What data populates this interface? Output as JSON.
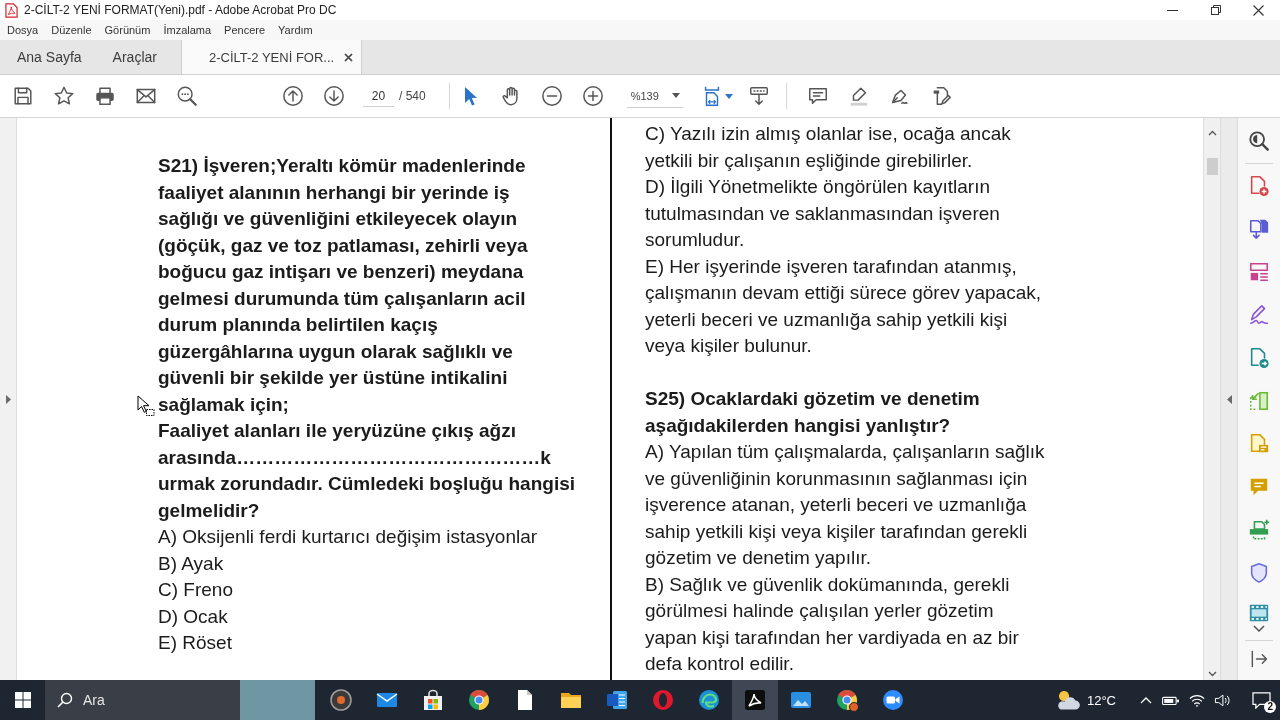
{
  "window": {
    "title": "2-CİLT-2 YENİ FORMAT(Yeni).pdf - Adobe Acrobat Pro DC"
  },
  "menu_bar": {
    "items": [
      "Dosya",
      "Düzenle",
      "Görünüm",
      "İmzalama",
      "Pencere",
      "Yardım"
    ]
  },
  "tabs": [
    {
      "label": "Ana Sayfa",
      "kind": "home",
      "selected": false
    },
    {
      "label": "Araçlar",
      "kind": "tools",
      "selected": false
    },
    {
      "label": "2-CİLT-2 YENİ FOR...",
      "kind": "document",
      "selected": true
    }
  ],
  "toolbar": {
    "page_number": "20",
    "page_of": "/ 540",
    "zoom": "%139",
    "tools": [
      {
        "kind": "select",
        "selected": true
      },
      {
        "kind": "hand",
        "selected": false
      }
    ]
  },
  "document": {
    "left_column": {
      "question": "S21) İşveren;Yeraltı kömür madenlerinde\nfaaliyet alanının herhangi bir yerinde iş\nsağlığı ve güvenliğini etkileyecek olayın\n(göçük, gaz ve toz patlaması, zehirli veya\nboğucu gaz intişarı ve benzeri) meydana\ngelmesi durumunda tüm çalışanların acil\ndurum planında belirtilen kaçış\ngüzergâhlarına uygun olarak sağlıklı ve\ngüvenli bir şekilde yer üstüne intikalini\nsağlamak için;\nFaaliyet alanları ile yeryüzüne çıkış ağzı\narasında…………………………………………k\nurmak zorundadır. Cümledeki boşluğu hangisi\ngelmelidir?",
      "options": [
        "A) Oksijenli ferdi kurtarıcı değişim istasyonlar",
        "B) Ayak",
        "C) Freno",
        "D) Ocak",
        "E) Röset"
      ]
    },
    "right_column": {
      "options_continued": [
        "C) Yazılı izin almış olanlar ise, ocağa ancak\nyetkili bir çalışanın eşliğinde girebilirler.",
        "D) İlgili Yönetmelikte öngörülen kayıtların\ntutulmasından ve saklanmasından işveren\nsorumludur.",
        "E) Her işyerinde işveren tarafından atanmış,\nçalışmanın devam ettiği sürece görev yapacak,\nyeterli beceri ve uzmanlığa sahip yetkili kişi\nveya kişiler bulunur."
      ],
      "question": "S25) Ocaklardaki gözetim ve denetim\naşağıdakilerden hangisi yanlıştır?",
      "options": [
        "A) Yapılan tüm çalışmalarda, çalışanların sağlık\nve güvenliğinin korunmasının sağlanması için\nişverence atanan, yeterli beceri ve uzmanlığa\nsahip yetkili kişi veya kişiler tarafından gerekli\ngözetim ve denetim yapılır.",
        "B) Sağlık ve güvenlik dokümanında, gerekli\ngörülmesi halinde çalışılan yerler gözetim\nyapan kişi tarafından her vardiyada en az bir\ndefa kontrol edilir."
      ]
    }
  },
  "taskbar": {
    "search_placeholder": "Ara",
    "apps": [
      {
        "kind": "recorder",
        "active": false
      },
      {
        "kind": "mail",
        "active": false
      },
      {
        "kind": "store",
        "active": false
      },
      {
        "kind": "browser",
        "active": false
      },
      {
        "kind": "file",
        "active": false
      },
      {
        "kind": "folder",
        "active": false
      },
      {
        "kind": "word",
        "active": false
      },
      {
        "kind": "opera",
        "active": false
      },
      {
        "kind": "edge",
        "active": false
      },
      {
        "kind": "pdf",
        "active": true
      },
      {
        "kind": "photos",
        "active": false
      },
      {
        "kind": "browser_profile",
        "active": false
      },
      {
        "kind": "meeting",
        "active": false
      }
    ],
    "temperature": "12°C",
    "notification_count": "2"
  }
}
